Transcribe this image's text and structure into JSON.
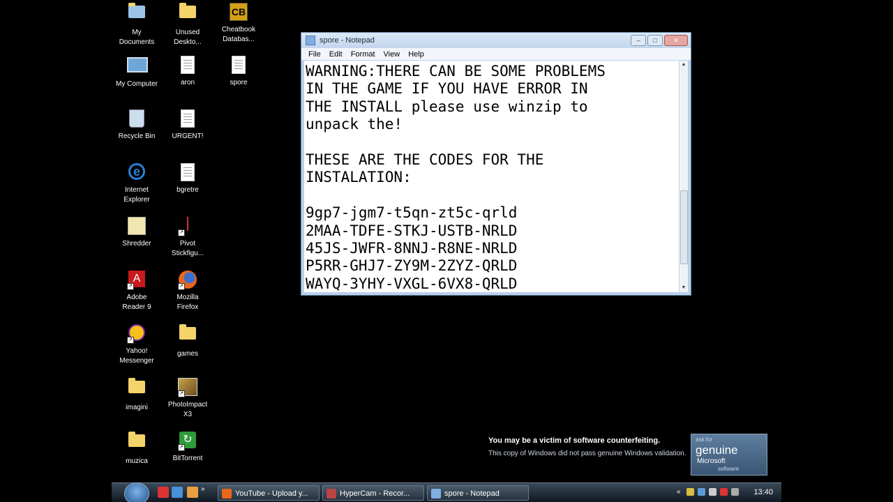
{
  "desktop": {
    "icons": [
      {
        "label": "My\nDocuments",
        "icon": "documents-icon"
      },
      {
        "label": "Unused\nDeskto...",
        "icon": "folder-icon"
      },
      {
        "label": "Cheatbook\nDatabas...",
        "icon": "cheatbook-icon"
      },
      {
        "label": "My Computer",
        "icon": "computer-icon"
      },
      {
        "label": "aron",
        "icon": "text-file-icon"
      },
      {
        "label": "spore",
        "icon": "text-file-icon"
      },
      {
        "label": "Recycle Bin",
        "icon": "recycle-bin-icon"
      },
      {
        "label": "URGENT!",
        "icon": "text-file-icon"
      },
      {
        "label": "Internet\nExplorer",
        "icon": "internet-explorer-icon"
      },
      {
        "label": "bgretre",
        "icon": "text-file-icon"
      },
      {
        "label": "Shredder",
        "icon": "shredder-icon"
      },
      {
        "label": "Pivot\nStickfigu...",
        "icon": "stickfigure-icon"
      },
      {
        "label": "Adobe\nReader 9",
        "icon": "adobe-reader-icon"
      },
      {
        "label": "Mozilla\nFirefox",
        "icon": "firefox-icon"
      },
      {
        "label": "Yahoo!\nMessenger",
        "icon": "yahoo-messenger-icon"
      },
      {
        "label": "games",
        "icon": "folder-icon"
      },
      {
        "label": "imagini",
        "icon": "folder-icon"
      },
      {
        "label": "PhotoImpact\nX3",
        "icon": "photoimpact-icon"
      },
      {
        "label": "muzica",
        "icon": "folder-icon"
      },
      {
        "label": "BitTorrent",
        "icon": "bittorrent-icon"
      }
    ]
  },
  "notepad": {
    "title": "spore - Notepad",
    "buttons": {
      "minimize": "–",
      "maximize": "□",
      "close": "✕"
    },
    "menu": {
      "file": "File",
      "edit": "Edit",
      "format": "Format",
      "view": "View",
      "help": "Help"
    },
    "content": "WARNING:THERE CAN BE SOME PROBLEMS\nIN THE GAME IF YOU HAVE ERROR IN\nTHE INSTALL please use winzip to\nunpack the!\n\nTHESE ARE THE CODES FOR THE\nINSTALATION:\n\n9gp7-jgm7-t5qn-zt5c-qrld\n2MAA-TDFE-STKJ-USTB-NRLD\n45JS-JWFR-8NNJ-R8NE-NRLD\nP5RR-GHJ7-ZY9M-2ZYZ-QRLD\nWAYQ-3YHY-VXGL-6VX8-QRLD",
    "scroll_up": "▲",
    "scroll_down": "▼"
  },
  "genuine": {
    "headline": "You may be a victim of software counterfeiting.",
    "body": "This copy of Windows did not pass genuine Windows validation.",
    "badge_ask": "ask for",
    "badge_genuine": "genuine",
    "badge_microsoft": "Microsoft",
    "badge_software": "software"
  },
  "taskbar": {
    "tasks": [
      {
        "label": "YouTube - Upload y...",
        "icon": "firefox-icon"
      },
      {
        "label": "HyperCam - Recor...",
        "icon": "hypercam-icon"
      },
      {
        "label": "spore - Notepad",
        "icon": "notepad-icon"
      }
    ],
    "quicklaunch_more": "»",
    "tray_more": "«",
    "clock": "13:40"
  },
  "colors": {
    "desktop": "#000000",
    "taskbar": "#26323e",
    "window_frame": "#b9d1ea"
  }
}
